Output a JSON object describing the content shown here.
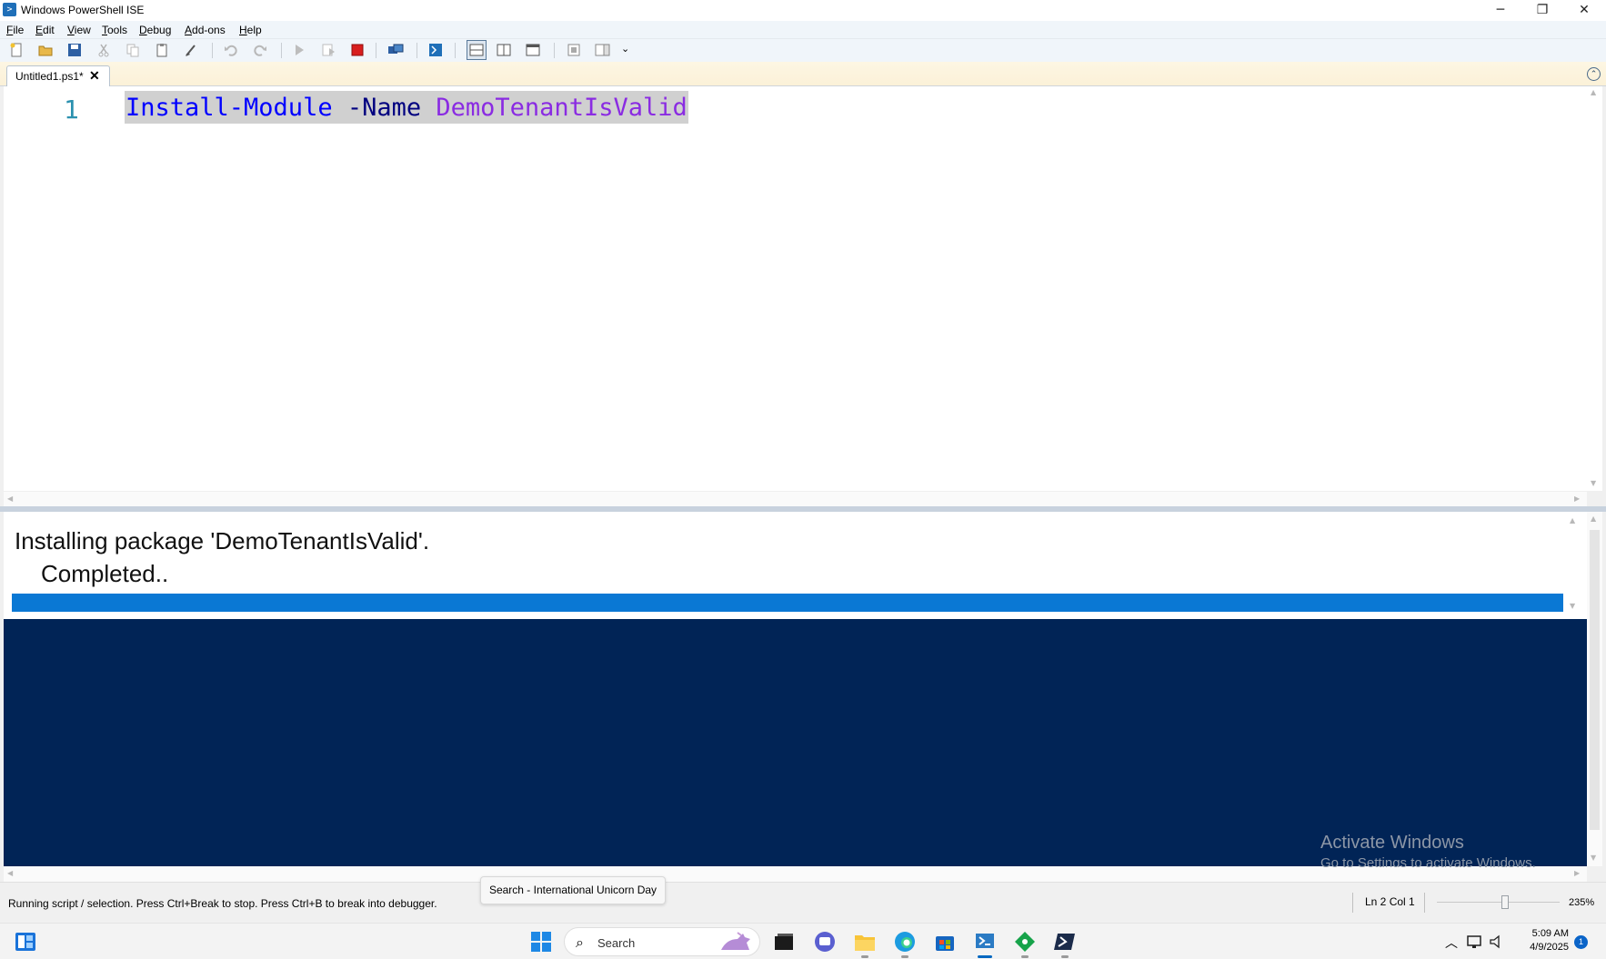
{
  "window": {
    "title": "Windows PowerShell ISE",
    "minimize_glyph": "─",
    "restore_glyph": "❐",
    "close_glyph": "✕"
  },
  "menu": {
    "items": [
      {
        "underline": "F",
        "rest": "ile"
      },
      {
        "underline": "E",
        "rest": "dit"
      },
      {
        "underline": "V",
        "rest": "iew"
      },
      {
        "underline": "T",
        "rest": "ools"
      },
      {
        "underline": "D",
        "rest": "ebug"
      },
      {
        "underline": "A",
        "rest": "dd-ons"
      },
      {
        "underline": "H",
        "rest": "elp"
      }
    ]
  },
  "toolbar": {
    "icons": [
      "new-script-icon",
      "open-icon",
      "save-icon",
      "cut-icon",
      "copy-icon",
      "paste-icon",
      "clear-console-icon",
      "undo-icon",
      "redo-icon",
      "run-script-icon",
      "run-selection-icon",
      "stop-icon",
      "new-remote-tab-icon",
      "start-powershell-icon",
      "show-script-top-icon",
      "show-script-right-icon",
      "show-script-max-icon",
      "show-commands-icon",
      "show-addon-icon"
    ],
    "overflow_glyph": "⌄"
  },
  "tab": {
    "label": "Untitled1.ps1*",
    "close_glyph": "✕",
    "collapse_glyph": "⌃"
  },
  "editor": {
    "line_number": "1",
    "tokens": {
      "command": "Install-Module",
      "parameter": "-Name",
      "argument": "DemoTenantIsValid"
    },
    "scroll_up": "▲",
    "scroll_down": "▼",
    "scroll_left": "◀",
    "scroll_right": "▶"
  },
  "progress": {
    "activity": "Installing package 'DemoTenantIsValid'.",
    "status": "Completed..",
    "percent": 100,
    "bar_color": "#0a78d4"
  },
  "console": {
    "background": "#012456",
    "watermark_title": "Activate Windows",
    "watermark_subtitle": "Go to Settings to activate Windows."
  },
  "tooltip": {
    "text": "Search - International Unicorn Day"
  },
  "status": {
    "message": "Running script / selection.  Press Ctrl+Break to stop.  Press Ctrl+B to break into debugger.",
    "position": "Ln 2  Col 1",
    "zoom": "235%"
  },
  "taskbar": {
    "search_placeholder": "Search",
    "search_glyph": "⌕",
    "time": "5:09 AM",
    "date": "4/9/2025",
    "notifications": "1",
    "tray_chevron": "︿"
  }
}
